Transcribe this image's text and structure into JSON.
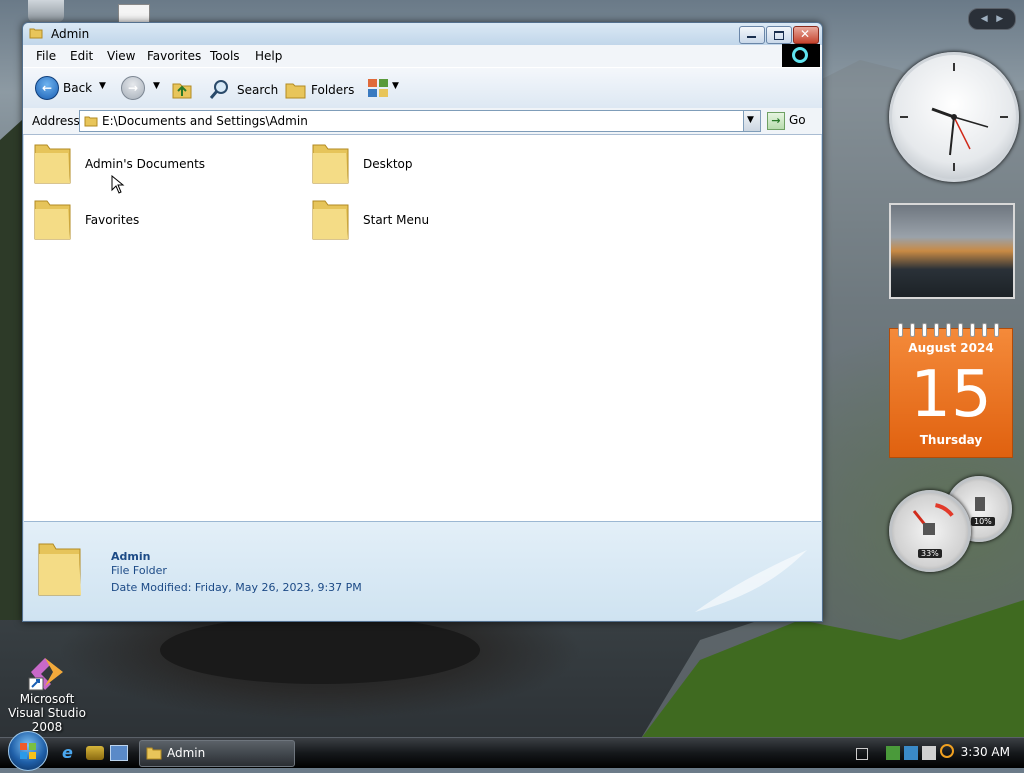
{
  "desktop": {
    "icons": [
      {
        "label": "Microsoft Visual Studio 2008"
      }
    ]
  },
  "window": {
    "title": "Admin",
    "menu": [
      "File",
      "Edit",
      "View",
      "Favorites",
      "Tools",
      "Help"
    ],
    "toolbar": {
      "back_label": "Back",
      "search_label": "Search",
      "folders_label": "Folders"
    },
    "address": {
      "label": "Address",
      "value": "E:\\Documents and Settings\\Admin",
      "go_label": "Go"
    },
    "folders": [
      {
        "name": "Admin's Documents"
      },
      {
        "name": "Desktop"
      },
      {
        "name": "Favorites"
      },
      {
        "name": "Start Menu"
      }
    ],
    "details": {
      "name": "Admin",
      "type": "File Folder",
      "modified": "Date Modified: Friday, May 26, 2023, 9:37 PM"
    }
  },
  "gadgets": {
    "calendar": {
      "month": "August 2024",
      "day": "15",
      "weekday": "Thursday"
    },
    "cpu_meter": {
      "cpu": "33%",
      "memory": "10%"
    }
  },
  "taskbar": {
    "window_button": "Admin",
    "clock": "3:30 AM"
  }
}
